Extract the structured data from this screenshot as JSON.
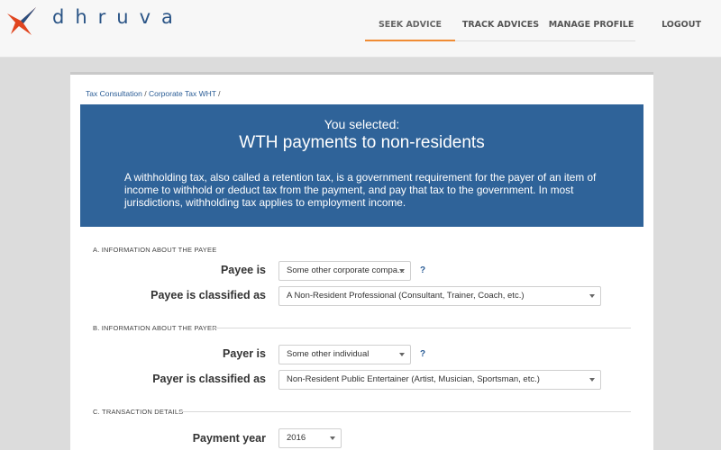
{
  "brand": {
    "name": "dhruva",
    "accent": "#f08c34",
    "primary": "#2f6399"
  },
  "nav": {
    "items": [
      {
        "label": "SEEK ADVICE",
        "active": true
      },
      {
        "label": "TRACK ADVICES",
        "active": false
      },
      {
        "label": "MANAGE PROFILE",
        "active": false
      },
      {
        "label": "LOGOUT",
        "active": false
      }
    ]
  },
  "breadcrumb": {
    "items": [
      "Tax Consultation",
      "Corporate Tax WHT"
    ],
    "separator": "/"
  },
  "banner": {
    "kicker": "You selected:",
    "title": "WTH payments to non-residents",
    "description": "A withholding tax, also called a retention tax, is a government requirement for the payer of an item of income to withhold or deduct tax from the payment, and pay that tax to the government. In most jurisdictions, withholding tax applies to employment income."
  },
  "sections": {
    "payee": {
      "title": "A. INFORMATION ABOUT THE PAYEE",
      "fields": {
        "payee_is": {
          "label": "Payee is",
          "value": "Some other corporate compa..."
        },
        "payee_class": {
          "label": "Payee is classified as",
          "value": "A Non-Resident Professional (Consultant, Trainer, Coach, etc.)"
        }
      },
      "help": "?"
    },
    "payer": {
      "title": "B. INFORMATION ABOUT THE PAYER",
      "fields": {
        "payer_is": {
          "label": "Payer is",
          "value": "Some other individual"
        },
        "payer_class": {
          "label": "Payer is classified as",
          "value": "Non-Resident Public Entertainer (Artist, Musician, Sportsman, etc.)"
        }
      },
      "help": "?"
    },
    "transaction": {
      "title": "C. TRANSACTION DETAILS",
      "fields": {
        "payment_year": {
          "label": "Payment year",
          "value": "2016"
        }
      }
    }
  },
  "icons": [
    "logo-star-icon",
    "chevron-down-icon",
    "help-icon"
  ]
}
